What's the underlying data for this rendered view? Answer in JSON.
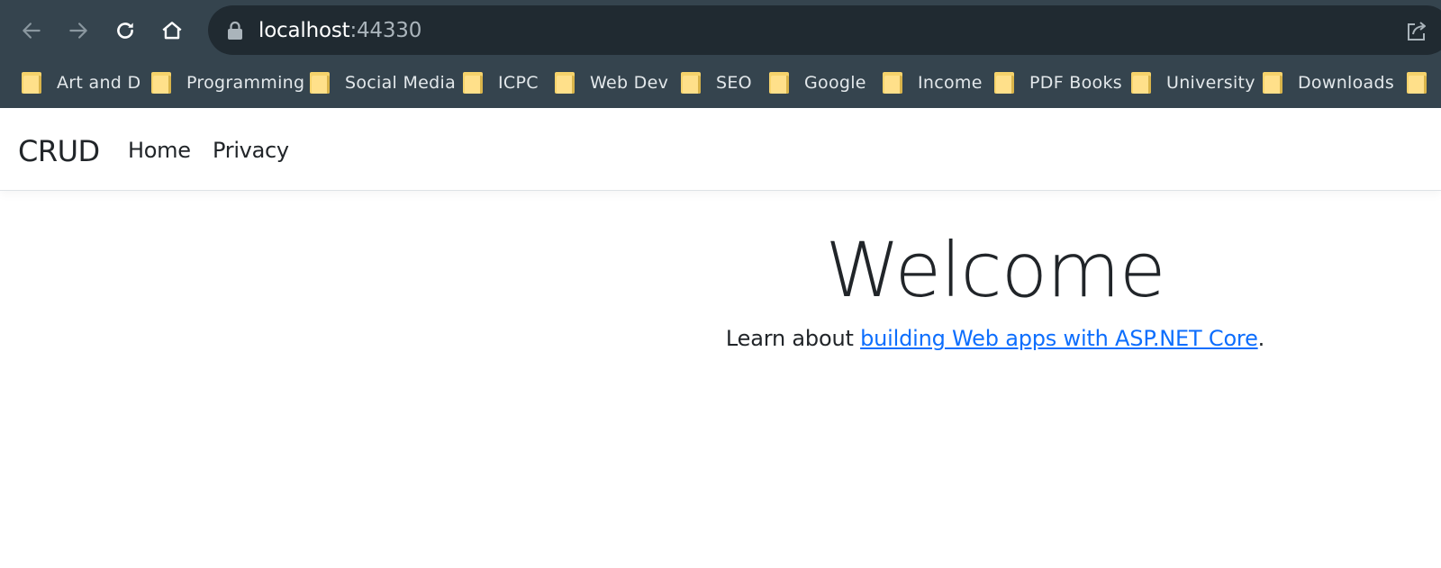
{
  "browser": {
    "url_host": "localhost",
    "url_port": ":44330",
    "icons": {
      "back": "arrow-left-icon",
      "forward": "arrow-right-icon",
      "reload": "reload-icon",
      "home": "home-icon",
      "lock": "lock-icon",
      "share": "share-icon"
    },
    "bookmarks": [
      {
        "label": "Art and D"
      },
      {
        "label": "Programming"
      },
      {
        "label": "Social Media"
      },
      {
        "label": "ICPC"
      },
      {
        "label": "Web Dev"
      },
      {
        "label": "SEO"
      },
      {
        "label": "Google"
      },
      {
        "label": "Income"
      },
      {
        "label": "PDF Books"
      },
      {
        "label": "University"
      },
      {
        "label": "Downloads"
      }
    ]
  },
  "site": {
    "brand": "CRUD",
    "nav": [
      {
        "label": "Home"
      },
      {
        "label": "Privacy"
      }
    ],
    "heading": "Welcome",
    "learn_prefix": "Learn about ",
    "learn_link": "building Web apps with ASP.NET Core",
    "learn_suffix": "."
  },
  "colors": {
    "chrome_bg": "#35444e",
    "omnibox_bg": "#202a31",
    "link": "#0d6efd",
    "text": "#212529"
  }
}
